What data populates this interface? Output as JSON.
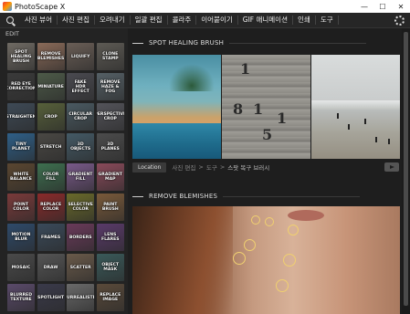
{
  "window": {
    "title": "PhotoScape X",
    "minimize": "—",
    "maximize": "☐",
    "close": "✕"
  },
  "menu": {
    "items": [
      "사진 뷰어",
      "사진 편집",
      "오려내기",
      "일괄 편집",
      "콜라주",
      "이어붙이기",
      "GIF 애니메이션",
      "인쇄",
      "도구"
    ]
  },
  "panel": {
    "label": "EDIT",
    "tiles": [
      {
        "label": "SPOT\nHEALING\nBRUSH",
        "color": "#6f6a63"
      },
      {
        "label": "REMOVE\nBLEMISHES",
        "color": "#8a6a58"
      },
      {
        "label": "LIQUIFY",
        "color": "#6a5e56"
      },
      {
        "label": "CLONE\nSTAMP",
        "color": "#5d5a54"
      },
      {
        "label": "RED EYE\nCORRECTION",
        "color": "#3a3a3a"
      },
      {
        "label": "MINIATURE",
        "color": "#4d5a48"
      },
      {
        "label": "FAKE\nHDR EFFECT",
        "color": "#4a4a50"
      },
      {
        "label": "REMOVE\nHAZE & FOG",
        "color": "#556066"
      },
      {
        "label": "STRAIGHTEN",
        "color": "#3e4a56"
      },
      {
        "label": "CROP",
        "color": "#57603a"
      },
      {
        "label": "CIRCULAR\nCROP",
        "color": "#4a5a62"
      },
      {
        "label": "PERSPECTIVE\nCROP",
        "color": "#54545a"
      },
      {
        "label": "TINY\nPLANET",
        "color": "#2e5f87"
      },
      {
        "label": "STRETCH",
        "color": "#4a4844"
      },
      {
        "label": "3D\nOBJECTS",
        "color": "#445a66"
      },
      {
        "label": "3D\nPLANES",
        "color": "#4c4c4c"
      },
      {
        "label": "WHITE\nBALANCE",
        "color": "#5a4630"
      },
      {
        "label": "COLOR\nFILL",
        "color": "#3d6f4f"
      },
      {
        "label": "GRADIENT\nFILL",
        "color": "#7a5a8a"
      },
      {
        "label": "GRADIENT\nMAP",
        "color": "#8a4a5a"
      },
      {
        "label": "POINT\nCOLOR",
        "color": "#7a3a3a"
      },
      {
        "label": "REPLACE\nCOLOR",
        "color": "#8a2a2a"
      },
      {
        "label": "SELECTIVE\nCOLOR",
        "color": "#6a6a2a"
      },
      {
        "label": "PAINT\nBRUSH",
        "color": "#7a5a3a"
      },
      {
        "label": "MOTION\nBLUR",
        "color": "#2e4a6a"
      },
      {
        "label": "FRAMES",
        "color": "#3a4a5a"
      },
      {
        "label": "BORDERS",
        "color": "#6a3a5a"
      },
      {
        "label": "LENS\nFLARES",
        "color": "#5a3a6a"
      },
      {
        "label": "MOSAIC",
        "color": "#4a4a4a"
      },
      {
        "label": "DRAW",
        "color": "#555555"
      },
      {
        "label": "SCATTER",
        "color": "#6a5a4a"
      },
      {
        "label": "OBJECT\nMASK",
        "color": "#3a5a5a"
      },
      {
        "label": "BLURRED\nTEXTURE",
        "color": "#5a4a6a"
      },
      {
        "label": "SPOTLIGHT",
        "color": "#3a3a4a"
      },
      {
        "label": "SURREALISTIC",
        "color": "#6a6a6a"
      },
      {
        "label": "REPLACE\nIMAGE",
        "color": "#5a4a3a"
      }
    ]
  },
  "content": {
    "section1": {
      "title": "SPOT HEALING BRUSH",
      "location_button": "Location",
      "breadcrumb": [
        "사진 편집",
        ">",
        "도구",
        ">",
        "스팟 복구 브러시"
      ]
    },
    "section2": {
      "title": "REMOVE BLEMISHES"
    }
  },
  "icons": {
    "search": "search-icon",
    "settings": "gear-icon",
    "video": "video-icon"
  }
}
